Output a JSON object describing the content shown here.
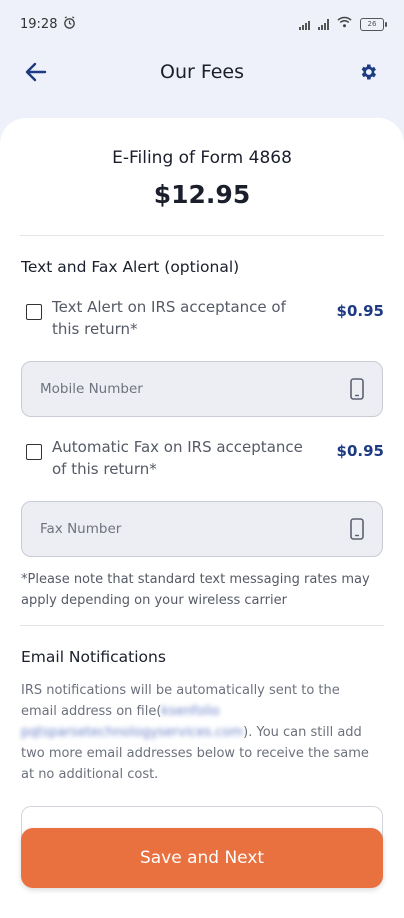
{
  "status_bar": {
    "time": "19:28",
    "battery": "26"
  },
  "header": {
    "title": "Our Fees"
  },
  "fee": {
    "title": "E-Filing of Form 4868",
    "price": "$12.95"
  },
  "alerts": {
    "section_title": "Text and Fax Alert (optional)",
    "text_alert": {
      "label": "Text Alert on IRS acceptance of this return*",
      "price": "$0.95",
      "checked": false
    },
    "mobile_input": {
      "placeholder": "Mobile Number",
      "value": ""
    },
    "fax_alert": {
      "label": "Automatic Fax on IRS acceptance of this return*",
      "price": "$0.95",
      "checked": false
    },
    "fax_input": {
      "placeholder": "Fax Number",
      "value": ""
    },
    "note": "*Please note that standard text messaging rates may apply depending on your wireless carrier"
  },
  "email": {
    "section_title": "Email Notifications",
    "desc_before": "IRS notifications will be automatically sent to the email address on file(",
    "email_address": "ksenfolio pqtsparsetechnologyservices.com",
    "desc_after": "). You can still add two more email addresses below to receive the same at no additional cost."
  },
  "footer": {
    "save_label": "Save and Next"
  },
  "colors": {
    "accent": "#e9703f",
    "brand_blue": "#1d3a82",
    "background": "#eef1f9"
  }
}
